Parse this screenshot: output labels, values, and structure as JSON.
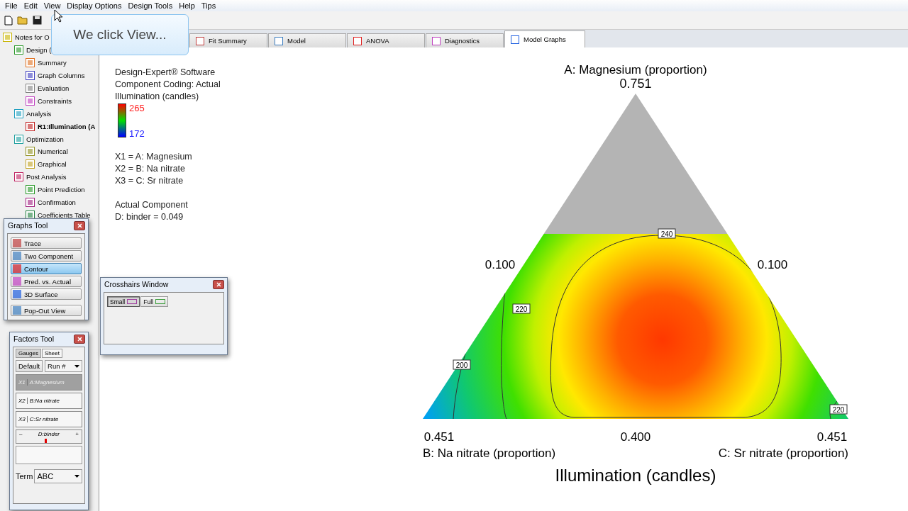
{
  "menu": [
    "File",
    "Edit",
    "View",
    "Display Options",
    "Design Tools",
    "Help",
    "Tips"
  ],
  "callout": {
    "text": "We click View..."
  },
  "tree": [
    {
      "label": "Notes for O",
      "selected": false,
      "children": [
        {
          "label": "Design (",
          "selected": false,
          "children": [
            {
              "label": "Summary",
              "selected": false
            },
            {
              "label": "Graph Columns",
              "selected": false
            },
            {
              "label": "Evaluation",
              "selected": false
            },
            {
              "label": "Constraints",
              "selected": false
            }
          ]
        },
        {
          "label": "Analysis",
          "selected": false,
          "children": [
            {
              "label": "R1:Illumination (A",
              "selected": true
            }
          ]
        },
        {
          "label": "Optimization",
          "selected": false,
          "children": [
            {
              "label": "Numerical",
              "selected": false
            },
            {
              "label": "Graphical",
              "selected": false
            }
          ]
        },
        {
          "label": "Post Analysis",
          "selected": false,
          "children": [
            {
              "label": "Point Prediction",
              "selected": false
            },
            {
              "label": "Confirmation",
              "selected": false
            },
            {
              "label": "Coefficients Table",
              "selected": false
            }
          ]
        }
      ]
    }
  ],
  "tabs": [
    {
      "label": "Fit Summary",
      "selected": false
    },
    {
      "label": "Model",
      "selected": false
    },
    {
      "label": "ANOVA",
      "selected": false
    },
    {
      "label": "Diagnostics",
      "selected": false
    },
    {
      "label": "Model Graphs",
      "selected": true
    }
  ],
  "legend": {
    "lines": [
      "Design-Expert® Software",
      "Component Coding: Actual",
      "Illumination (candles)"
    ],
    "high": "265",
    "low": "172",
    "factors": [
      "X1 = A: Magnesium",
      "X2 = B: Na nitrate",
      "X3 = C: Sr nitrate"
    ],
    "component": [
      "Actual Component",
      "D: binder = 0.049"
    ]
  },
  "plot": {
    "top_label": "A: Magnesium (proportion)",
    "top_value": "0.751",
    "left_value": "0.100",
    "right_value": "0.100",
    "bottom_left_value": "0.451",
    "bottom_center_value": "0.400",
    "bottom_right_value": "0.451",
    "left_axis": "B: Na nitrate (proportion)",
    "right_axis": "C: Sr nitrate (proportion)",
    "title": "Illumination (candles)",
    "contour_labels": [
      "240",
      "220",
      "200",
      "220"
    ]
  },
  "graphs_tool": {
    "title": "Graphs Tool",
    "buttons": [
      {
        "label": "Trace",
        "selected": false
      },
      {
        "label": "Two Component",
        "selected": false
      },
      {
        "label": "Contour",
        "selected": true
      },
      {
        "label": "Pred. vs. Actual",
        "selected": false
      },
      {
        "label": "3D Surface",
        "selected": false
      },
      {
        "label": "Pop-Out View",
        "selected": false
      }
    ]
  },
  "crosshairs": {
    "title": "Crosshairs Window",
    "buttons": [
      {
        "label": "Small",
        "selected": true
      },
      {
        "label": "Full",
        "selected": false
      }
    ]
  },
  "factors_tool": {
    "title": "Factors Tool",
    "tabs": [
      {
        "label": "Gauges",
        "selected": true
      },
      {
        "label": "Sheet",
        "selected": false
      }
    ],
    "default_button": "Default",
    "run_select": "Run #",
    "factors": [
      {
        "code": "X1",
        "name": "A:Magnesium",
        "selected": true
      },
      {
        "code": "X2",
        "name": "B:Na nitrate",
        "selected": false
      },
      {
        "code": "X3",
        "name": "C:Sr nitrate",
        "selected": false
      }
    ],
    "slider": {
      "label": "D:binder",
      "minus": "–",
      "plus": "+",
      "level": 0.43
    },
    "term_label": "Term",
    "term_value": "ABC"
  }
}
